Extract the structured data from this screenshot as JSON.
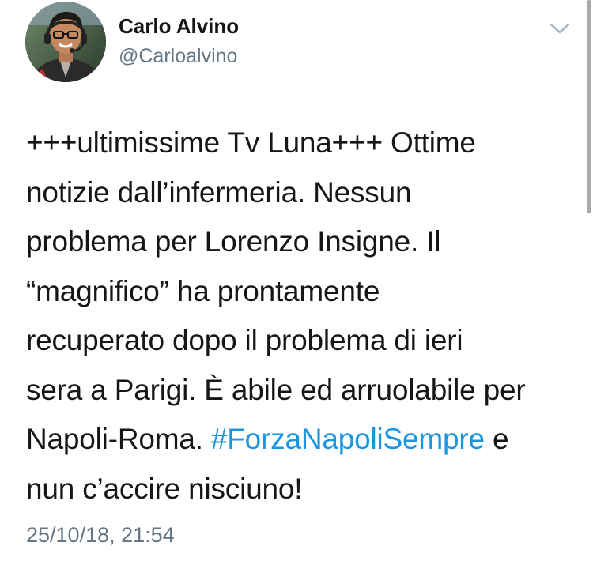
{
  "tweet": {
    "author": {
      "display_name": "Carlo Alvino",
      "handle": "@Carloalvino"
    },
    "text_lines": [
      "+++ultimissime Tv Luna+++ Ottime",
      "notizie dall’infermeria. Nessun",
      "problema per Lorenzo Insigne. Il",
      "“magnifico” ha prontamente",
      "recuperato dopo il problema di ieri",
      "sera a Parigi. È abile ed arruolabile per"
    ],
    "line7_before": "Napoli-Roma. ",
    "hashtag": "#ForzaNapoliSempre",
    "line7_after": " e",
    "line8": "nun c’accire nisciuno!",
    "timestamp": "25/10/18, 21:54"
  },
  "icons": {
    "menu": "chevron-down-icon"
  },
  "colors": {
    "text": "#14171a",
    "secondary": "#657786",
    "link": "#1b95e0"
  }
}
